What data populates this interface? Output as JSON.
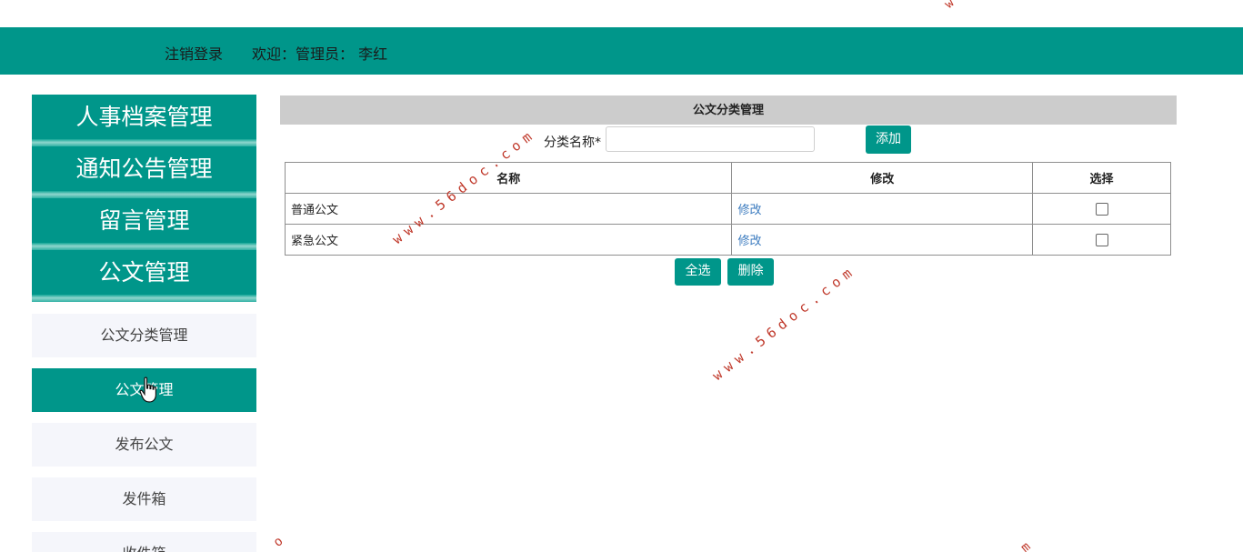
{
  "header": {
    "logout_label": "注销登录",
    "welcome_text": "欢迎：管理员： 李红"
  },
  "sidebar": {
    "major_items": [
      {
        "label": "人事档案管理"
      },
      {
        "label": "通知公告管理"
      },
      {
        "label": "留言管理"
      },
      {
        "label": "公文管理"
      }
    ],
    "sub_items": [
      {
        "label": "公文分类管理",
        "active": false
      },
      {
        "label": "公文管理",
        "active": true
      },
      {
        "label": "发布公文",
        "active": false
      },
      {
        "label": "发件箱",
        "active": false
      },
      {
        "label": "收件箱",
        "active": false
      }
    ]
  },
  "main": {
    "title": "公文分类管理",
    "form": {
      "label": "分类名称*",
      "input_value": "",
      "add_label": "添加"
    },
    "table": {
      "headers": [
        "名称",
        "修改",
        "选择"
      ],
      "rows": [
        {
          "name": "普通公文",
          "edit": "修改",
          "checked": false
        },
        {
          "name": "紧急公文",
          "edit": "修改",
          "checked": false
        }
      ]
    },
    "actions": {
      "select_all_label": "全选",
      "delete_label": "删除"
    }
  },
  "watermark": {
    "text": "www.56doc.com",
    "fragment_o": "o",
    "fragment_m": "m",
    "fragment_w": "w"
  },
  "colors": {
    "primary": "#00968a",
    "sub_menu_bg": "#f5f6fb",
    "title_bar": "#cccccc",
    "link": "#3b7bbf",
    "watermark": "#c0392b"
  }
}
